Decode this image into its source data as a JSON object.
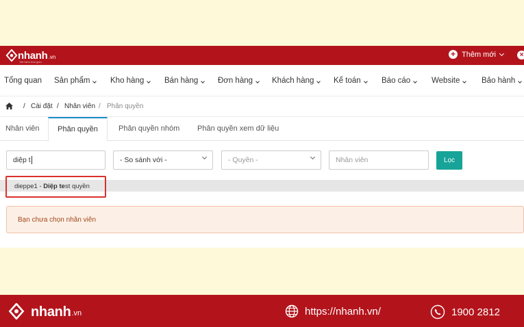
{
  "brand": {
    "name": "nhanh",
    "tld": ".vn",
    "slogan": "Tiết kiệm thời gian"
  },
  "topbar": {
    "add_new_label": "Thêm mới"
  },
  "menu": [
    {
      "label": "Tổng quan"
    },
    {
      "label": "Sản phẩm"
    },
    {
      "label": "Kho hàng"
    },
    {
      "label": "Bán hàng"
    },
    {
      "label": "Đơn hàng"
    },
    {
      "label": "Khách hàng"
    },
    {
      "label": "Kế toán"
    },
    {
      "label": "Báo cáo"
    },
    {
      "label": "Website"
    },
    {
      "label": "Bảo hành"
    }
  ],
  "breadcrumb": {
    "sep": "/",
    "items": [
      "Cài đặt",
      "Nhân viên",
      "Phân quyền"
    ]
  },
  "tabs": [
    {
      "label": "Nhân viên"
    },
    {
      "label": "Phân quyền"
    },
    {
      "label": "Phân quyền nhóm"
    },
    {
      "label": "Phân quyền xem dữ liệu"
    }
  ],
  "filters": {
    "search_value": "diệp t",
    "compare_select": "- So sánh với -",
    "permission_select": "- Quyền -",
    "employee_placeholder": "Nhân viên",
    "filter_button": "Lọc"
  },
  "suggestion": {
    "prefix": "dieppe1 - ",
    "match_bold": "Diệp te",
    "rest": "st quyền"
  },
  "alert": {
    "message": "Bạn chưa chọn nhân viên"
  },
  "footer": {
    "website": "https://nhanh.vn/",
    "phone": "1900 2812"
  },
  "colors": {
    "brand_red": "#b3141c",
    "accent_blue": "#1a8ec8",
    "button_teal": "#17a398",
    "highlight_red": "#d9302a"
  }
}
